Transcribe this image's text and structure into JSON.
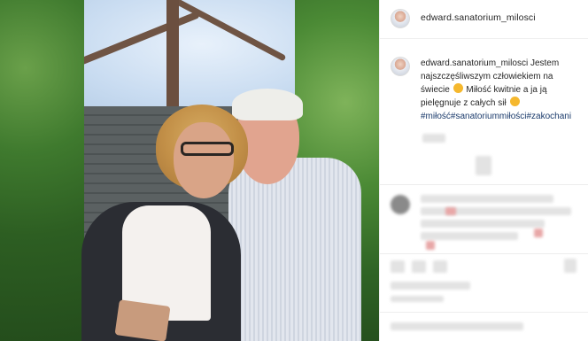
{
  "post": {
    "username": "edward.sanatorium_milosci"
  },
  "caption": {
    "username": "edward.sanatorium_milosci",
    "line1": "Jestem najszczęśliwszym człowiekiem na świecie",
    "line2": "Miłość kwitnie a ja ją pielęgnuje z całych sił",
    "hashtags": "#miłość#sanatoriummiłości#zakochani"
  },
  "icons": {
    "avatar": "avatar-photo",
    "emoji1": "heart-eyes-emoji",
    "emoji2": "smiling-emoji"
  }
}
